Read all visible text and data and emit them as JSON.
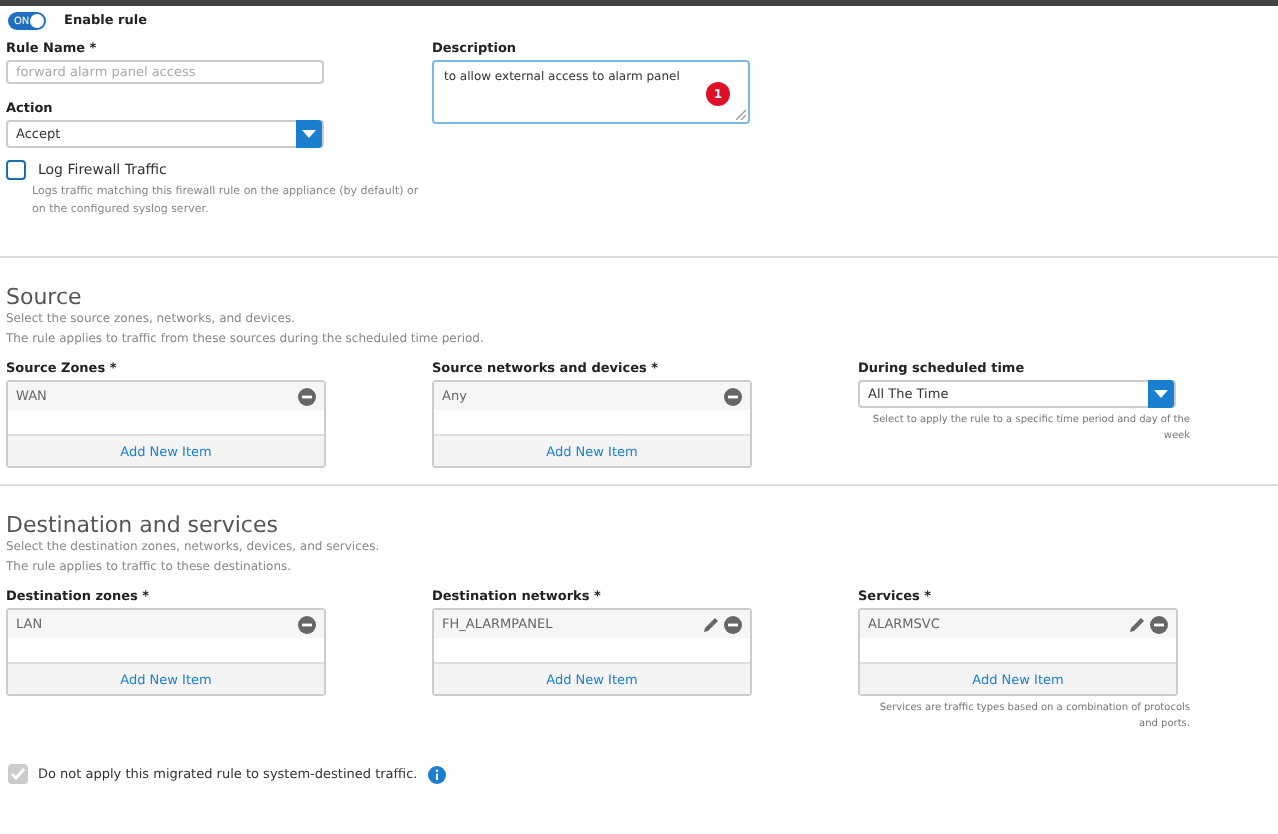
{
  "enable_rule": {
    "label": "Enable rule",
    "toggle_text": "ON",
    "on": true
  },
  "rule_name": {
    "label": "Rule Name *",
    "placeholder": "forward alarm panel access"
  },
  "action": {
    "label": "Action",
    "value": "Accept"
  },
  "log_traffic": {
    "label": "Log Firewall Traffic",
    "checked": false,
    "hint": "Logs traffic matching this firewall rule on the appliance (by default) or on the configured syslog server."
  },
  "description": {
    "label": "Description",
    "value": "to allow external access to alarm panel",
    "badge": "1"
  },
  "source": {
    "title": "Source",
    "lines": [
      "Select the source zones, networks, and devices.",
      "The rule applies to traffic from these sources during the scheduled time period."
    ],
    "fields": [
      {
        "kind": "list",
        "label": "Source Zones *",
        "items": [
          {
            "text": "WAN",
            "editable": false
          }
        ],
        "add": "Add New Item"
      },
      {
        "kind": "list",
        "label": "Source networks and devices *",
        "items": [
          {
            "text": "Any",
            "editable": false
          }
        ],
        "add": "Add New Item"
      },
      {
        "kind": "select",
        "label": "During scheduled time",
        "value": "All The Time",
        "hint": "Select to apply the rule to a specific time period and day of the week"
      }
    ]
  },
  "destination": {
    "title": "Destination and services",
    "lines": [
      "Select the destination zones, networks, devices, and services.",
      "The rule applies to traffic to these destinations."
    ],
    "fields": [
      {
        "kind": "list",
        "label": "Destination zones *",
        "items": [
          {
            "text": "LAN",
            "editable": false
          }
        ],
        "add": "Add New Item"
      },
      {
        "kind": "list",
        "label": "Destination networks *",
        "items": [
          {
            "text": "FH_ALARMPANEL",
            "editable": true
          }
        ],
        "add": "Add New Item"
      },
      {
        "kind": "list",
        "label": "Services *",
        "items": [
          {
            "text": "ALARMSVC",
            "editable": true
          }
        ],
        "add": "Add New Item",
        "hint": "Services are traffic types based on a combination of protocols and ports."
      }
    ]
  },
  "system_traffic": {
    "label": "Do not apply this migrated rule to system-destined traffic.",
    "checked": true,
    "disabled": true
  }
}
